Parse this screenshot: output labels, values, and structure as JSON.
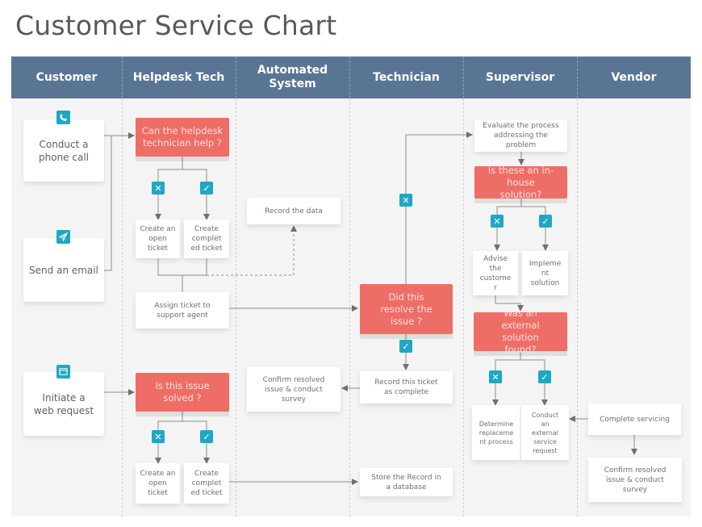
{
  "title": "Customer Service Chart",
  "lanes": [
    {
      "label": "Customer"
    },
    {
      "label": "Helpdesk Tech"
    },
    {
      "label": "Automated System"
    },
    {
      "label": "Technician"
    },
    {
      "label": "Supervisor"
    },
    {
      "label": "Vendor"
    }
  ],
  "colors": {
    "header": "#5a7594",
    "decision": "#ef6d67",
    "badge": "#1ea7c5",
    "board": "#f4f4f4"
  },
  "customer": {
    "phone": {
      "label": "Conduct a phone call",
      "icon": "phone-icon"
    },
    "email": {
      "label": "Send an email",
      "icon": "paper-plane-icon"
    },
    "web": {
      "label": "Initiate a web request",
      "icon": "browser-window-icon"
    }
  },
  "helpdesk": {
    "decision1": "Can the helpdesk technician help ?",
    "open_ticket_1": "Create an open ticket",
    "completed_ticket_1": "Create complet ed ticket",
    "assign": "Assign ticket to support agent",
    "decision2": "Is this issue solved ?",
    "open_ticket_2": "Create an open ticket",
    "completed_ticket_2": "Create complet ed ticket"
  },
  "automated": {
    "record_data": "Record the data",
    "confirm_survey": "Confirm resolved issue & conduct survey"
  },
  "technician": {
    "decision": "Did this resolve the issue ?",
    "record_complete": "Record this ticket as complete",
    "store_record": "Store the Record in a database"
  },
  "supervisor": {
    "evaluate": "Evaluate the process addressing the problem",
    "decision1": "Is these an in-house solution?",
    "advise": "Advise the custome r",
    "implement": "Impleme nt solution",
    "decision2": "Was an external solution found?",
    "determine": "Determine replaceme nt process",
    "conduct_external": "Conduct an external service request"
  },
  "vendor": {
    "complete_servicing": "Complete servicing",
    "confirm_survey": "Confirm resolved issue & conduct survey"
  },
  "badges": {
    "no": "✕",
    "yes": "✓"
  }
}
